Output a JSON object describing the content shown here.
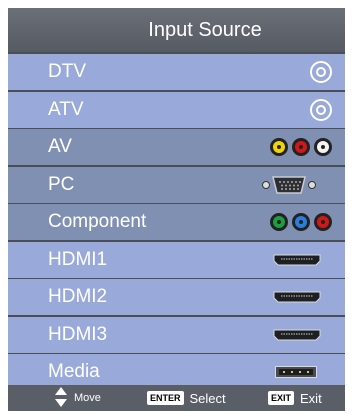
{
  "title": "Input Source",
  "sources": [
    {
      "label": "DTV",
      "icon": "antenna-icon"
    },
    {
      "label": "ATV",
      "icon": "antenna-icon"
    },
    {
      "label": "AV",
      "icon": "composite-rca-icon"
    },
    {
      "label": "PC",
      "icon": "vga-port-icon"
    },
    {
      "label": "Component",
      "icon": "component-rca-icon"
    },
    {
      "label": "HDMI1",
      "icon": "hdmi-port-icon"
    },
    {
      "label": "HDMI2",
      "icon": "hdmi-port-icon"
    },
    {
      "label": "HDMI3",
      "icon": "hdmi-port-icon"
    },
    {
      "label": "Media",
      "icon": "usb-port-icon"
    }
  ],
  "footer": {
    "move_label": "Move",
    "enter_key": "ENTER",
    "select_label": "Select",
    "exit_key": "EXIT",
    "exit_label": "Exit"
  },
  "colors": {
    "row_primary": "#99a9d9",
    "row_secondary": "#8090b3",
    "title_bar": "#5e626a",
    "footer_bar": "#5a5e66"
  }
}
